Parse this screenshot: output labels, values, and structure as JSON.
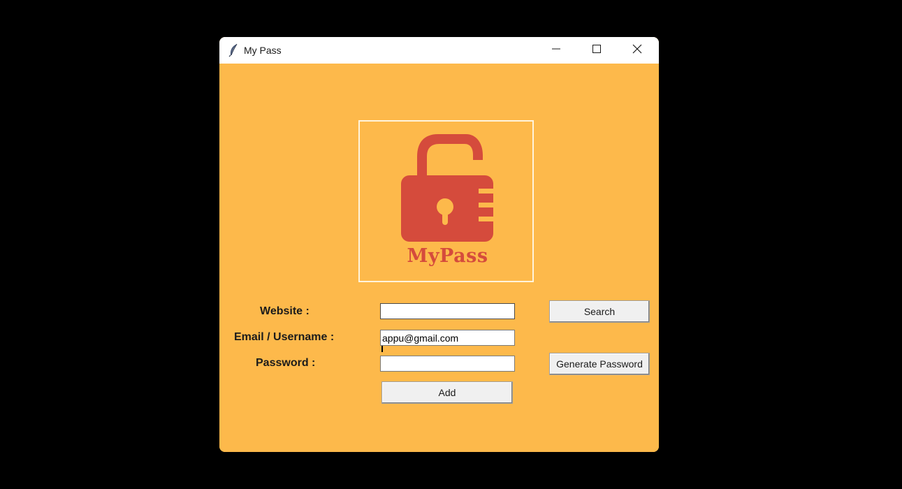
{
  "window": {
    "title": "My Pass",
    "controls": {
      "minimize": "minimize-icon",
      "maximize": "maximize-icon",
      "close": "close-icon"
    }
  },
  "logo": {
    "icon": "padlock-unlocked-icon",
    "text": "MyPass",
    "color": "#d54b3c"
  },
  "form": {
    "website_label": "Website :",
    "website_value": "",
    "email_label": "Email / Username :",
    "email_value": "appu@gmail.com",
    "password_label": "Password :",
    "password_value": ""
  },
  "buttons": {
    "search": "Search",
    "generate": "Generate Password",
    "add": "Add"
  },
  "colors": {
    "background": "#fdb94b",
    "desktop": "#000000",
    "titlebar": "#ffffff"
  }
}
